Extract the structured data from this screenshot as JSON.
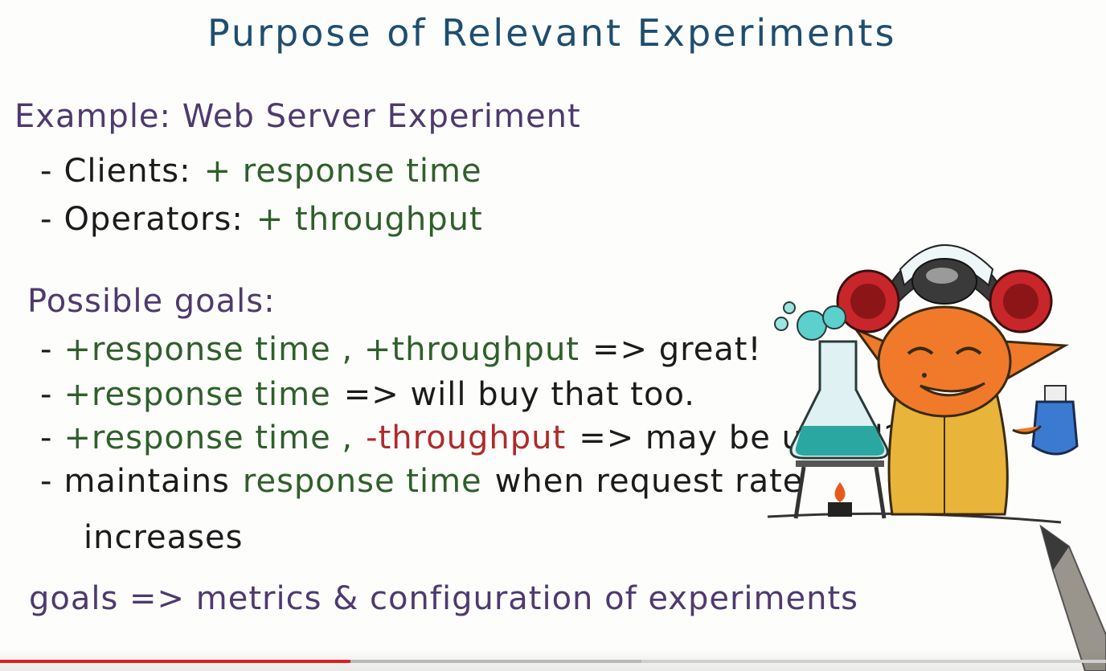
{
  "slide": {
    "title": "Purpose of Relevant Experiments",
    "example_heading": "Example: Web Server Experiment",
    "clients": {
      "label": "Clients:",
      "value": "+ response time"
    },
    "operators": {
      "label": "Operators:",
      "value": "+ throughput"
    },
    "goals_heading": "Possible goals:",
    "goal_1": {
      "green": "+response time , +throughput",
      "black": "=> great!"
    },
    "goal_2": {
      "green": "+response time",
      "black": "=> will buy that too."
    },
    "goal_3": {
      "green": "+response time ,",
      "red": "-throughput",
      "black": "=> may be useful?"
    },
    "goal_4": {
      "black_a": "maintains",
      "green": "response time",
      "black_b": "when request rate"
    },
    "goal_4_cont": "increases",
    "summary": "goals => metrics & configuration of experiments"
  },
  "player": {
    "progress_fraction": 0.317,
    "buffered_fraction": 0.58
  },
  "colors": {
    "title": "#1f4e6e",
    "purple": "#4e3a6e",
    "green": "#2f5f2a",
    "red": "#b02a2a",
    "progress": "#e01e1e"
  },
  "icons": {
    "illustration": "scientist-with-flask-icon",
    "pen": "pen-icon"
  }
}
